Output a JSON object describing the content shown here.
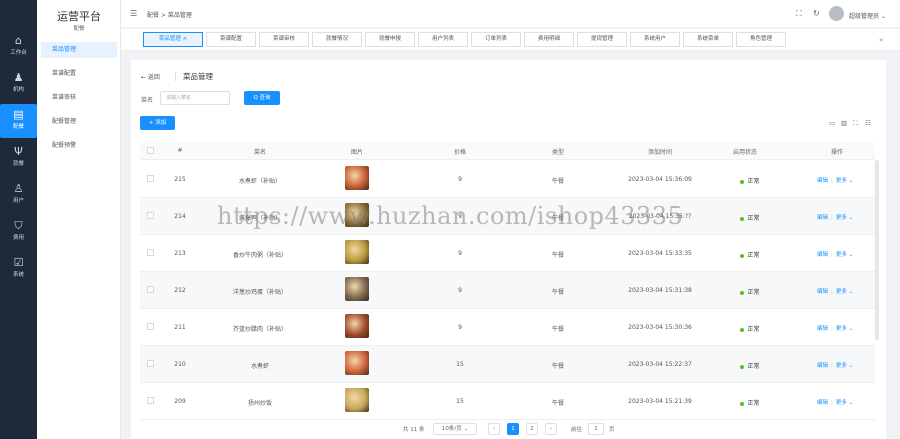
{
  "rail": [
    {
      "icon": "home-icon",
      "glyph": "⌂",
      "label": "工作台"
    },
    {
      "icon": "org-icon",
      "glyph": "♟",
      "label": "机构"
    },
    {
      "icon": "delivery-icon",
      "glyph": "▤",
      "label": "配餐",
      "active": true
    },
    {
      "icon": "dining-icon",
      "glyph": "Ψ",
      "label": "就餐"
    },
    {
      "icon": "user-icon",
      "glyph": "♙",
      "label": "用户"
    },
    {
      "icon": "shield-icon",
      "glyph": "⛉",
      "label": "费用"
    },
    {
      "icon": "system-icon",
      "glyph": "☑",
      "label": "系统"
    }
  ],
  "sidebar": {
    "brand": "运营平台",
    "brand_sub": "配餐",
    "items": [
      {
        "label": "菜品管理",
        "active": true
      },
      {
        "label": "菜谱配置"
      },
      {
        "label": "菜谱审核"
      },
      {
        "label": "配餐管理"
      },
      {
        "label": "配餐预警"
      }
    ]
  },
  "topbar": {
    "fold_glyph": "☰",
    "breadcrumb": "配餐  >  菜品管理",
    "fullscreen_glyph": "⛶",
    "refresh_glyph": "↻",
    "username": "超级管理员 ⌄"
  },
  "tabs": [
    {
      "label": "菜品管理 ×",
      "active": true
    },
    {
      "label": "菜谱配置"
    },
    {
      "label": "菜谱审核"
    },
    {
      "label": "就餐情况"
    },
    {
      "label": "就餐申报"
    },
    {
      "label": "用户列表"
    },
    {
      "label": "订单列表"
    },
    {
      "label": "费用明细"
    },
    {
      "label": "提现管理"
    },
    {
      "label": "系统用户"
    },
    {
      "label": "系统菜单"
    },
    {
      "label": "角色管理"
    }
  ],
  "tabs_more": "»",
  "page": {
    "back": "←  返回",
    "title": "菜品管理",
    "filter_label": "菜名",
    "filter_placeholder": "请输入菜名",
    "search_btn": "Q 查询",
    "add_btn": "+ 添加",
    "tools": [
      "▭",
      "▥",
      "⛶",
      "☷"
    ]
  },
  "table": {
    "columns": [
      "#",
      "菜名",
      "图片",
      "价格",
      "类型",
      "添加时间",
      "启用状态",
      "操作"
    ],
    "rows": [
      {
        "id": "215",
        "name": "水煮虾（补贴）",
        "price": "9",
        "type": "午餐",
        "time": "2023-03-04 15:36:09",
        "status": "正常",
        "img": "#c95d32"
      },
      {
        "id": "214",
        "name": "酱爆鸭（补贴）",
        "price": "9",
        "type": "午餐",
        "time": "2023-03-04 15:35:??",
        "status": "正常",
        "img": "#8a6b3a"
      },
      {
        "id": "213",
        "name": "香炒牛肉粥（补贴）",
        "price": "9",
        "type": "午餐",
        "time": "2023-03-04 15:33:35",
        "status": "正常",
        "img": "#b89a3c"
      },
      {
        "id": "212",
        "name": "洋葱炒鸡蛋（补贴）",
        "price": "9",
        "type": "午餐",
        "time": "2023-03-04 15:31:38",
        "status": "正常",
        "img": "#7d6850"
      },
      {
        "id": "211",
        "name": "芥蓝炒腊肉（补贴）",
        "price": "9",
        "type": "午餐",
        "time": "2023-03-04 15:30:36",
        "status": "正常",
        "img": "#a04a2a"
      },
      {
        "id": "210",
        "name": "水煮虾",
        "price": "15",
        "type": "午餐",
        "time": "2023-03-04 15:22:37",
        "status": "正常",
        "img": "#d0633a"
      },
      {
        "id": "209",
        "name": "扬州炒饭",
        "price": "15",
        "type": "午餐",
        "time": "2023-03-04 15:21:39",
        "status": "正常",
        "img": "#c9a85a"
      }
    ],
    "op_edit": "编辑",
    "op_more": "更多 ⌄"
  },
  "pagination": {
    "total": "共 11 条",
    "page_size": "10条/页  ⌄",
    "prev": "‹",
    "pages": [
      "1",
      "2"
    ],
    "next": "›",
    "goto_label": "前往",
    "goto_value": "1",
    "goto_suffix": "页"
  },
  "watermark": "https://www.huzhan.com/ishop43335"
}
